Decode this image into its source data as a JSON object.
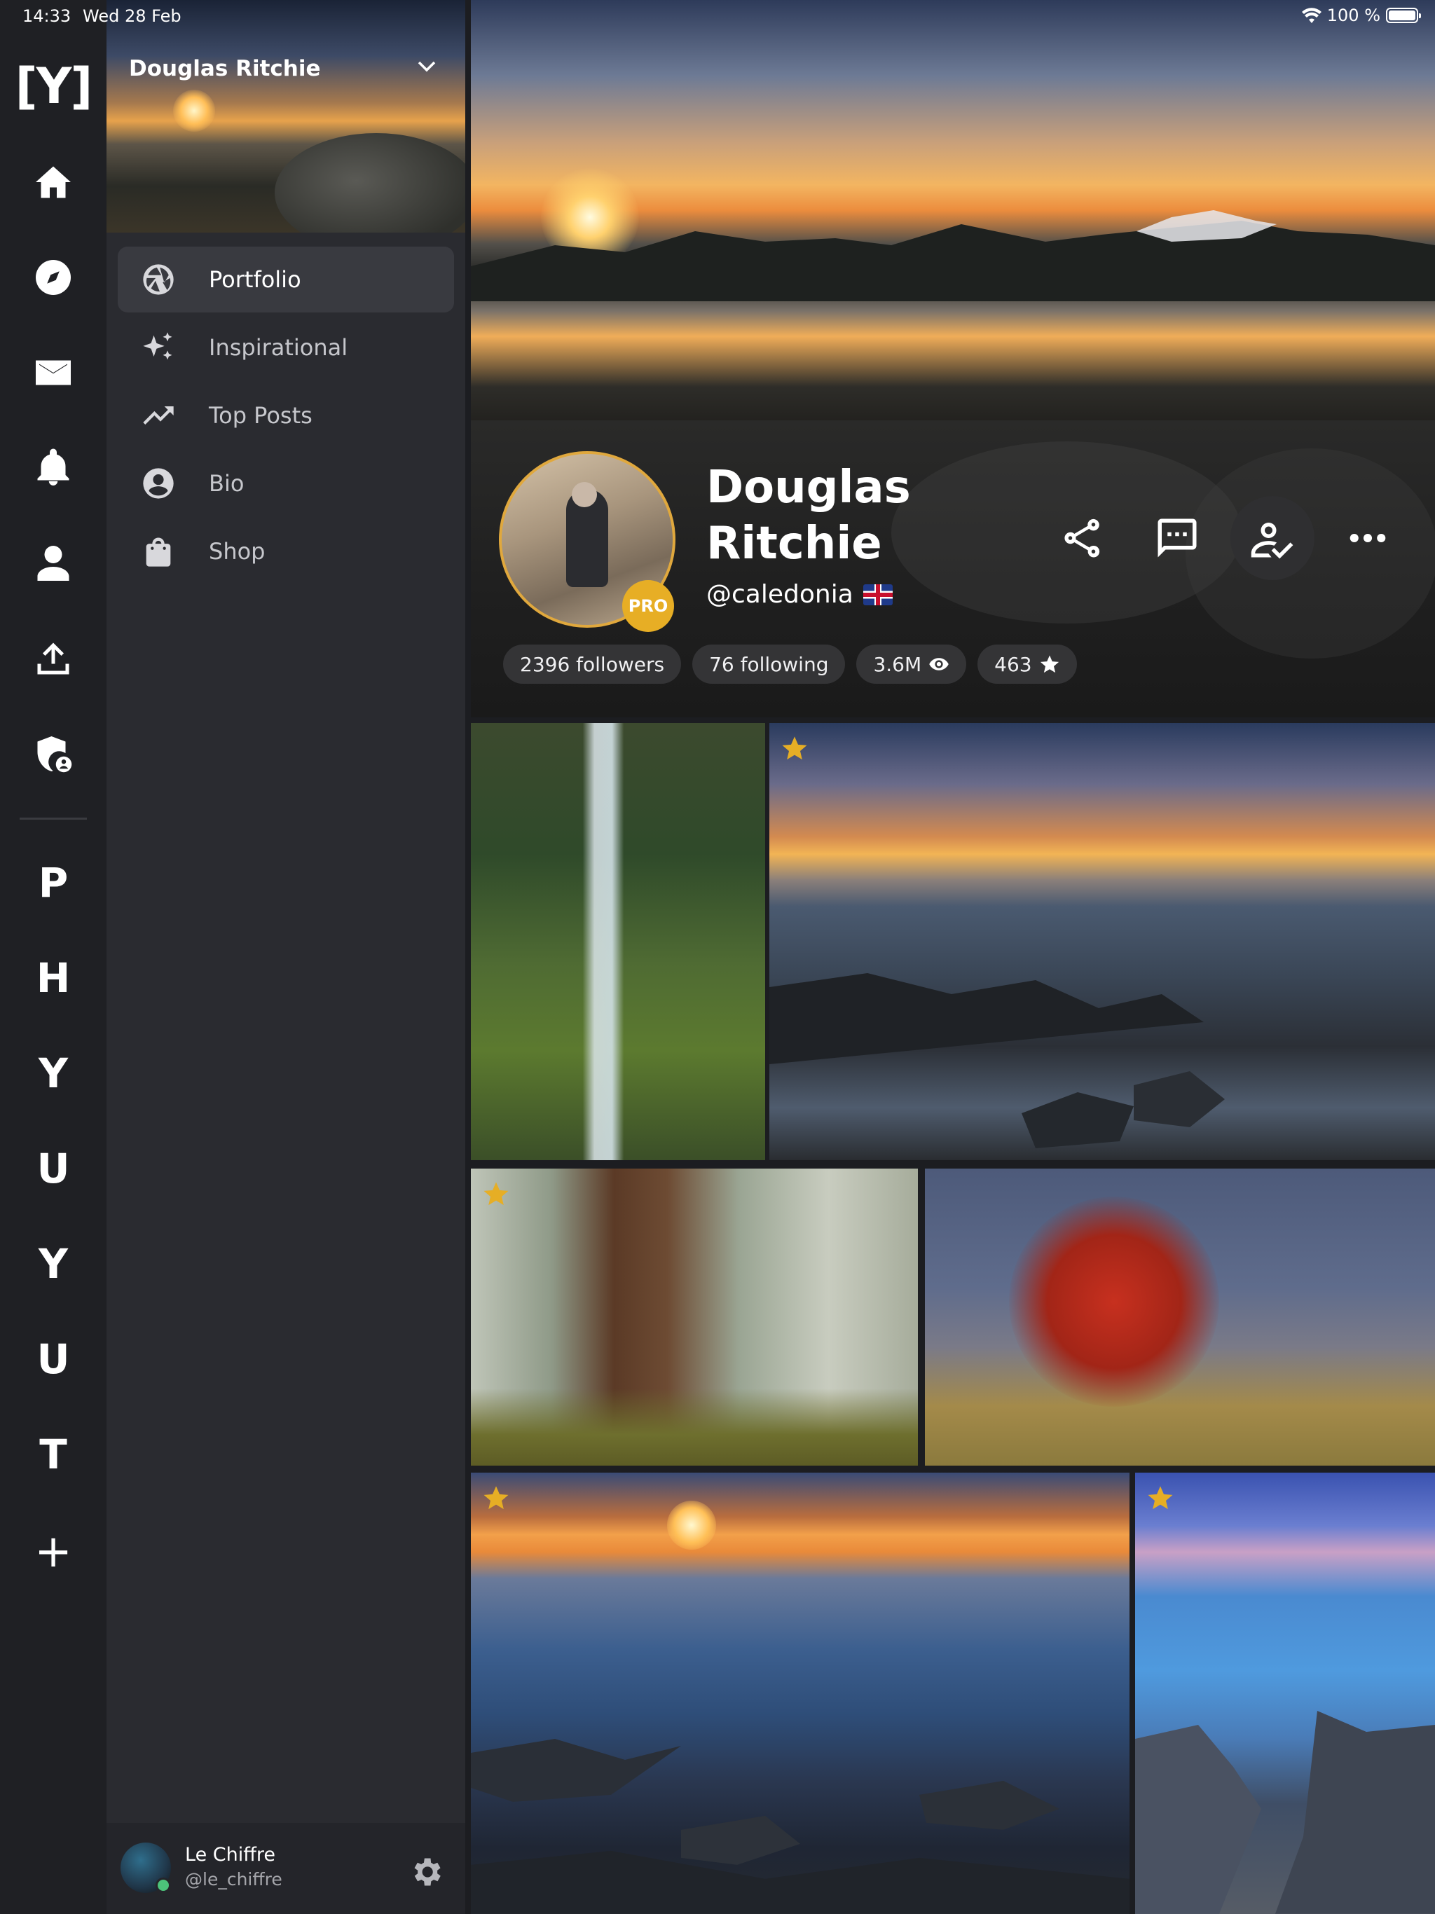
{
  "status_bar": {
    "time": "14:33",
    "date": "Wed 28 Feb",
    "battery": "100 %"
  },
  "rail": {
    "logo": "[Y]",
    "icons": [
      "home-icon",
      "compass-icon",
      "mail-icon",
      "bell-icon",
      "person-icon",
      "upload-icon",
      "shield-icon"
    ],
    "letters": [
      "P",
      "H",
      "Y",
      "U",
      "Y",
      "U",
      "T"
    ],
    "add_label": "+"
  },
  "drawer": {
    "profile_name": "Douglas Ritchie",
    "items": [
      {
        "label": "Portfolio",
        "icon": "aperture-icon",
        "active": true
      },
      {
        "label": "Inspirational",
        "icon": "sparkle-icon",
        "active": false
      },
      {
        "label": "Top Posts",
        "icon": "trending-icon",
        "active": false
      },
      {
        "label": "Bio",
        "icon": "account-circle-icon",
        "active": false
      },
      {
        "label": "Shop",
        "icon": "shopping-bag-icon",
        "active": false
      }
    ],
    "user": {
      "name": "Le Chiffre",
      "handle": "@le_chiffre"
    }
  },
  "profile": {
    "name": "Douglas Ritchie",
    "handle": "@caledonia",
    "badge": "PRO",
    "stats": {
      "followers": "2396 followers",
      "following": "76 following",
      "views": "3.6M",
      "stars": "463"
    }
  },
  "colors": {
    "accent": "#e6ae25",
    "rail_bg": "#1f2024",
    "drawer_bg": "#2a2b30"
  },
  "photos": [
    {
      "starred": false
    },
    {
      "starred": true
    },
    {
      "starred": true
    },
    {
      "starred": false
    },
    {
      "starred": true
    },
    {
      "starred": true
    }
  ]
}
